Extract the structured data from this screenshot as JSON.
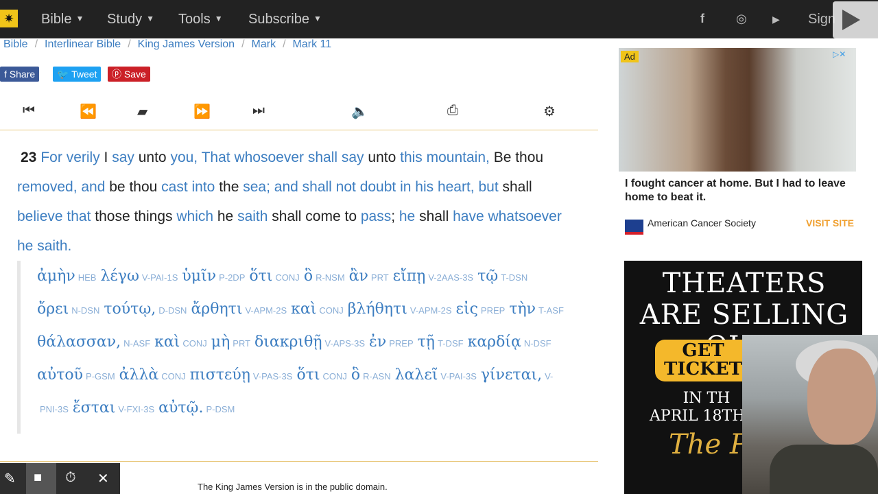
{
  "nav": {
    "items": [
      "Bible",
      "Study",
      "Tools",
      "Subscribe"
    ],
    "signin": "Sign"
  },
  "breadcrumb": [
    "Bible",
    "Interlinear Bible",
    "King James Version",
    "Mark",
    "Mark 11"
  ],
  "share": {
    "share": "Share",
    "tweet": "Tweet",
    "save": "Save"
  },
  "verse": {
    "number": "23",
    "text_segments": [
      [
        "For verily",
        true
      ],
      [
        " I ",
        false
      ],
      [
        "say",
        true
      ],
      [
        " unto ",
        false
      ],
      [
        "you, That whosoever shall say",
        true
      ],
      [
        " unto ",
        false
      ],
      [
        "this mountain,",
        true
      ],
      [
        " Be thou ",
        false
      ],
      [
        "removed, and",
        true
      ],
      [
        " be thou ",
        false
      ],
      [
        "cast into",
        true
      ],
      [
        " the ",
        false
      ],
      [
        "sea; and shall not doubt in his heart, but",
        true
      ],
      [
        " shall ",
        false
      ],
      [
        "believe that",
        true
      ],
      [
        " those things ",
        false
      ],
      [
        "which",
        true
      ],
      [
        " he ",
        false
      ],
      [
        "saith",
        true
      ],
      [
        " shall come to ",
        false
      ],
      [
        "pass",
        true
      ],
      [
        "; ",
        false
      ],
      [
        "he",
        true
      ],
      [
        " shall ",
        false
      ],
      [
        "have whatsoever he saith.",
        true
      ]
    ]
  },
  "interlinear": [
    [
      [
        "ἀμὴν",
        "HEB"
      ],
      [
        "λέγω",
        "V-PAI-1S"
      ],
      [
        "ὑμῖν",
        "P-2DP"
      ],
      [
        "ὅτι",
        "CONJ"
      ],
      [
        "ὃ",
        "R-NSM"
      ],
      [
        "ἂν",
        "PRT"
      ],
      [
        "εἴπῃ",
        "V-2AAS-3S"
      ],
      [
        "τῷ",
        "T-DSN"
      ]
    ],
    [
      [
        "ὄρει",
        "N-DSN"
      ],
      [
        "τούτῳ,",
        "D-DSN"
      ],
      [
        "ἄρθητι",
        "V-APM-2S"
      ],
      [
        "καὶ",
        "CONJ"
      ],
      [
        "βλήθητι",
        "V-APM-2S"
      ],
      [
        "εἰς",
        "PREP"
      ],
      [
        "τὴν",
        "T-ASF"
      ]
    ],
    [
      [
        "θάλασσαν,",
        "N-ASF"
      ],
      [
        "καὶ",
        "CONJ"
      ],
      [
        "μὴ",
        "PRT"
      ],
      [
        "διακριθῇ",
        "V-APS-3S"
      ],
      [
        "ἐν",
        "PREP"
      ],
      [
        "τῇ",
        "T-DSF"
      ],
      [
        "καρδίᾳ",
        "N-DSF"
      ]
    ],
    [
      [
        "αὐτοῦ",
        "P-GSM"
      ],
      [
        "ἀλλὰ",
        "CONJ"
      ],
      [
        "πιστεύῃ",
        "V-PAS-3S"
      ],
      [
        "ὅτι",
        "CONJ"
      ],
      [
        "ὃ",
        "R-ASN"
      ],
      [
        "λαλεῖ",
        "V-PAI-3S"
      ],
      [
        "γίνεται,",
        "V-"
      ]
    ],
    [
      [
        "",
        "PNI-3S"
      ],
      [
        "ἔσται",
        "V-FXI-3S"
      ],
      [
        "αὐτῷ.",
        "P-DSM"
      ]
    ]
  ],
  "footer_note": "The King James Version is in the public domain.",
  "ad1": {
    "badge": "Ad",
    "headline": "I fought cancer at home. But I had to leave home to beat it.",
    "advertiser": "American Cancer Society",
    "cta": "VISIT SITE"
  },
  "ad2": {
    "title": "THEATERS ARE SELLING OUT!",
    "button": "GET TICKET",
    "sub1": "IN TH",
    "sub2": "APRIL 18TH &",
    "brand": "The PILG"
  },
  "colors": {
    "link": "#3d7ec1",
    "nav_bg": "#222222",
    "accent": "#f0c419",
    "facebook": "#3b5998",
    "twitter": "#1da1f2",
    "pinterest": "#cb2027"
  }
}
